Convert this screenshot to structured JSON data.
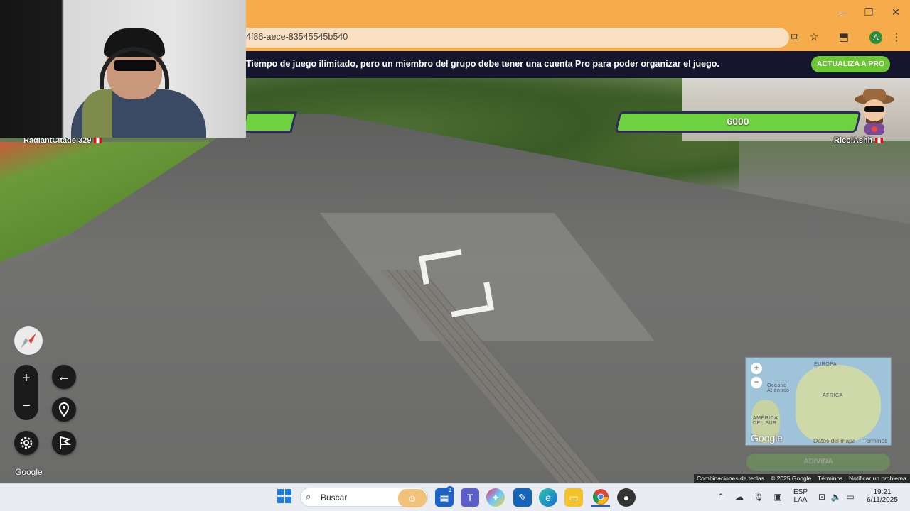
{
  "browser": {
    "url_fragment": "4f86-aece-83545545b540",
    "avatar_letter": "A",
    "window_controls": [
      "—",
      "❐",
      "✕"
    ]
  },
  "banner": {
    "text": "Tiempo de juego ilimitado, pero un miembro del grupo debe tener una cuenta Pro para poder organizar el juego.",
    "pro_button": "ACTUALIZA A PRO"
  },
  "players": {
    "left": {
      "name": "RadiantCitadel329"
    },
    "right": {
      "name": "RicolAshh",
      "health": "6000"
    }
  },
  "map_controls": {
    "zoom_in": "+",
    "zoom_out": "−",
    "back": "←",
    "google": "Google"
  },
  "minimap": {
    "labels": {
      "europe": "EUROPA",
      "africa": "ÁFRICA",
      "south_america": "AMÉRICA DEL SUR",
      "north_atlantic": "Océano Atlántico"
    },
    "google": "Google",
    "shortcuts": "Datos del mapa",
    "terms": "Términos",
    "zoom_in": "+",
    "zoom_out": "−",
    "guess_button": "ADIVINA"
  },
  "maps_footer": {
    "shortcuts": "Combinaciones de teclas",
    "copyright": "© 2025 Google",
    "terms": "Términos",
    "report": "Notificar un problema"
  },
  "taskbar": {
    "search_placeholder": "Buscar",
    "notification_count": "1",
    "language_top": "ESP",
    "language_bottom": "LAA",
    "time": "19:21",
    "date": "6/11/2025"
  },
  "colors": {
    "chrome_orange": "#f6ac4b",
    "banner_bg": "#16152e",
    "pro_green": "#6cc734",
    "health_green": "#6ed140",
    "health_border": "#2f2a5c"
  }
}
